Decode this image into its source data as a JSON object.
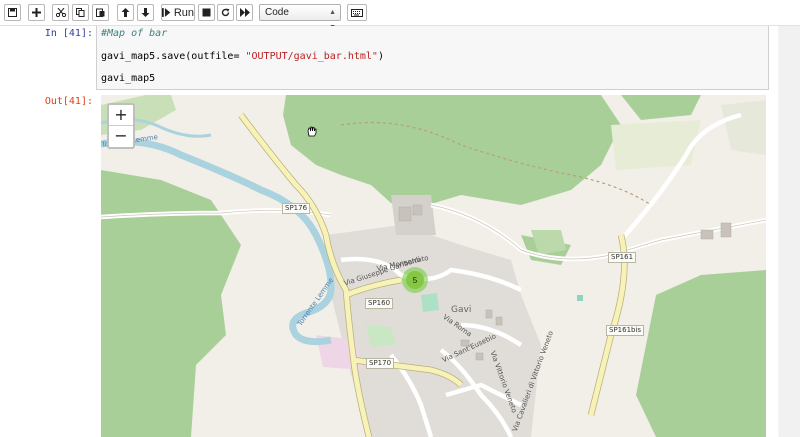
{
  "toolbar": {
    "run_label": "Run",
    "cell_type": "Code",
    "icons": [
      "save-icon",
      "add-cell-icon",
      "cut-icon",
      "copy-icon",
      "paste-icon",
      "move-up-icon",
      "move-down-icon",
      "run-icon",
      "stop-icon",
      "restart-icon",
      "fast-forward-icon",
      "keyboard-icon"
    ]
  },
  "cell": {
    "in_prompt": "In [41]:",
    "out_prompt": "Out[41]:",
    "lines": {
      "comment": "#Map of bar",
      "save_prefix": "gavi_map5.save(outfile= ",
      "save_string": "\"OUTPUT/gavi_bar.html\"",
      "save_suffix": ")",
      "show": "gavi_map5"
    }
  },
  "map": {
    "zoom_in": "+",
    "zoom_out": "−",
    "cluster_count": "5",
    "cluster_color": "#6ecc39",
    "roads": {
      "sp176": "SP176",
      "sp160": "SP160",
      "sp170": "SP170",
      "sp161": "SP161",
      "sp161bis": "SP161bis"
    },
    "town": "Gavi",
    "streets": {
      "garibaldi": "Via Giuseppe Garibaldi",
      "monserrato": "Via Monserrato",
      "roma": "Via Roma",
      "sant_eusebio": "Via Sant'Eusebio",
      "vittorio_veneto": "Via Vittorio Veneto",
      "cavalieri": "Via Cavalieri di Vittorio Veneto"
    },
    "rivers": {
      "lemme_top": "Torrente Lemme",
      "lemme_mid": "Torrente Lemme",
      "lemme_low": "Torrente Lemme"
    }
  }
}
